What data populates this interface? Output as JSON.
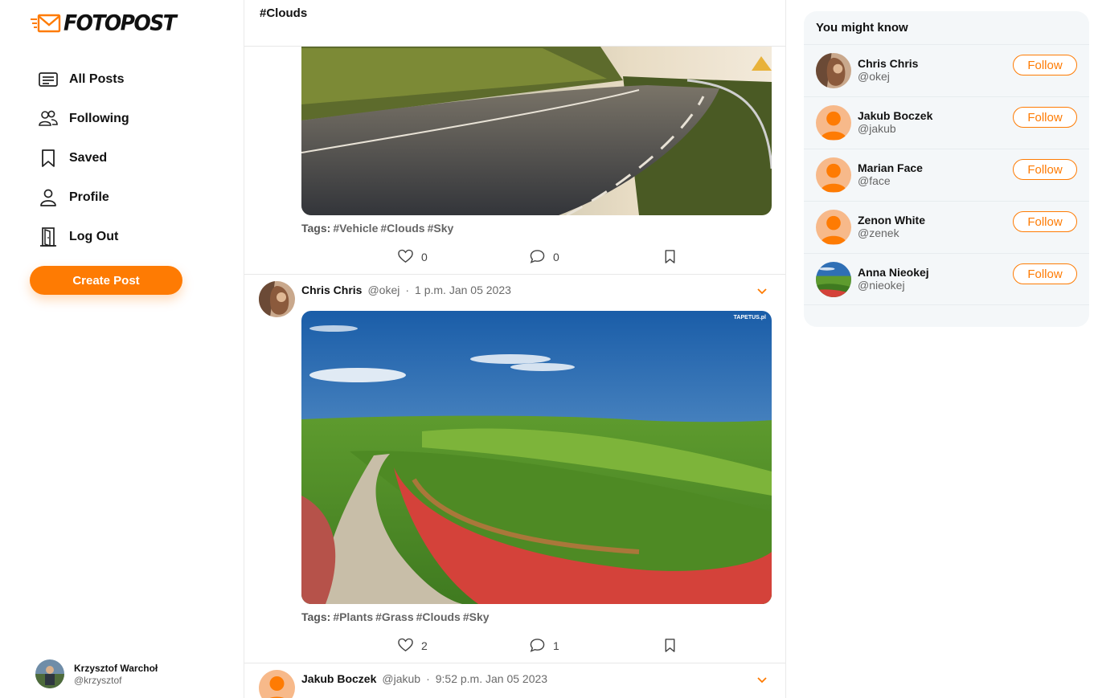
{
  "app": {
    "name": "FOTOPOST"
  },
  "nav": {
    "items": [
      {
        "label": "All Posts",
        "icon": "list-icon"
      },
      {
        "label": "Following",
        "icon": "users-icon"
      },
      {
        "label": "Saved",
        "icon": "bookmark-icon"
      },
      {
        "label": "Profile",
        "icon": "user-icon"
      },
      {
        "label": "Log Out",
        "icon": "door-icon"
      }
    ],
    "create_label": "Create Post"
  },
  "current_user": {
    "name": "Krzysztof Warchoł",
    "handle": "@krzysztof"
  },
  "feed": {
    "title": "#Clouds",
    "posts": [
      {
        "tags_label": "Tags:",
        "tags": [
          "#Vehicle",
          "#Clouds",
          "#Sky"
        ],
        "likes": "0",
        "comments": "0"
      },
      {
        "author": "Chris Chris",
        "handle": "@okej",
        "separator": "·",
        "time": "1 p.m. Jan 05 2023",
        "watermark": "TAPETUS.pl",
        "tags_label": "Tags:",
        "tags": [
          "#Plants",
          "#Grass",
          "#Clouds",
          "#Sky"
        ],
        "likes": "2",
        "comments": "1"
      },
      {
        "author": "Jakub Boczek",
        "handle": "@jakub",
        "separator": "·",
        "time": "9:52 p.m. Jan 05 2023"
      }
    ]
  },
  "suggestions": {
    "title": "You might know",
    "follow_label": "Follow",
    "users": [
      {
        "name": "Chris Chris",
        "handle": "@okej",
        "avatar": "photo"
      },
      {
        "name": "Jakub Boczek",
        "handle": "@jakub",
        "avatar": "default"
      },
      {
        "name": "Marian Face",
        "handle": "@face",
        "avatar": "default"
      },
      {
        "name": "Zenon White",
        "handle": "@zenek",
        "avatar": "default"
      },
      {
        "name": "Anna Nieokej",
        "handle": "@nieokej",
        "avatar": "landscape"
      }
    ]
  },
  "colors": {
    "accent": "#fe7b03",
    "avatar_bg": "#f7b98a",
    "panel_bg": "#f4f7f9"
  }
}
